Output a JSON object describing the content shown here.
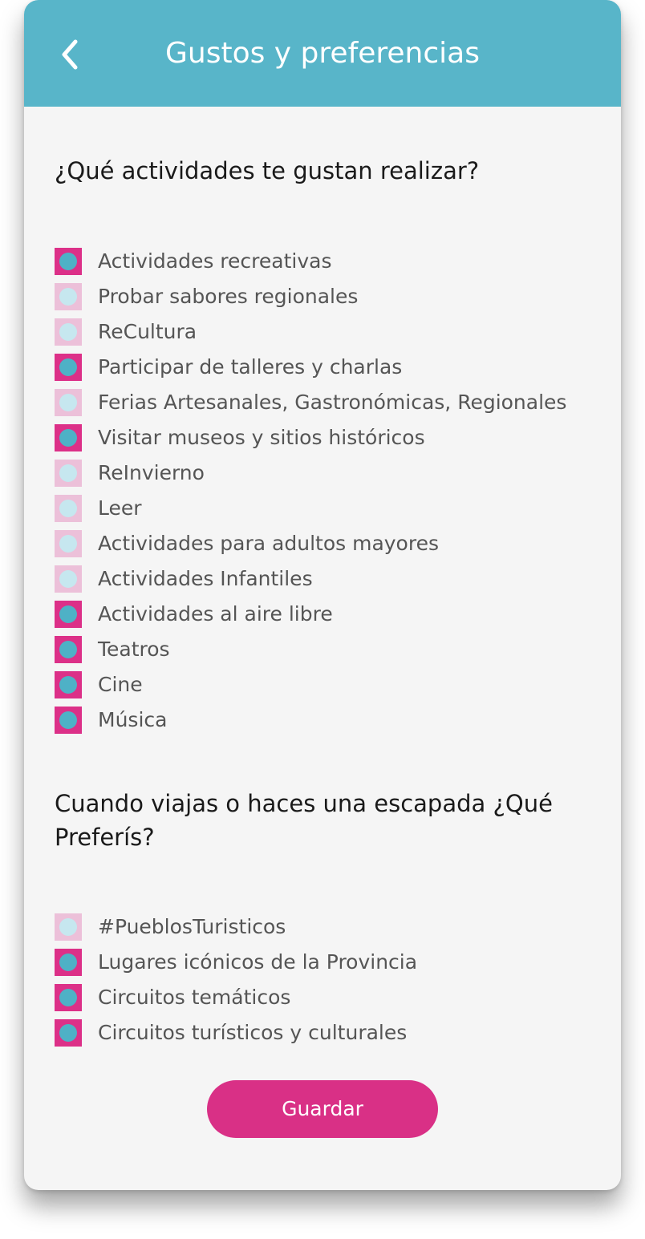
{
  "header": {
    "title": "Gustos y preferencias",
    "back_icon": "chevron-left-icon"
  },
  "colors": {
    "header_bg": "#58b5c9",
    "accent_pink": "#dc3088",
    "accent_teal": "#4eb1c6",
    "unchecked_pink": "#ecc0d9",
    "unchecked_teal": "#c6e7ef"
  },
  "activities": {
    "question": "¿Qué actividades te gustan realizar?",
    "options": [
      {
        "label": "Actividades recreativas",
        "checked": true
      },
      {
        "label": "Probar sabores regionales",
        "checked": false
      },
      {
        "label": "ReCultura",
        "checked": false
      },
      {
        "label": "Participar de talleres y charlas",
        "checked": true
      },
      {
        "label": "Ferias Artesanales, Gastronómicas, Regionales",
        "checked": false
      },
      {
        "label": "Visitar museos y sitios históricos",
        "checked": true
      },
      {
        "label": "ReInvierno",
        "checked": false
      },
      {
        "label": "Leer",
        "checked": false
      },
      {
        "label": "Actividades para adultos mayores",
        "checked": false
      },
      {
        "label": "Actividades Infantiles",
        "checked": false
      },
      {
        "label": "Actividades al aire libre",
        "checked": true
      },
      {
        "label": "Teatros",
        "checked": true
      },
      {
        "label": "Cine",
        "checked": true
      },
      {
        "label": "Música",
        "checked": true
      }
    ]
  },
  "travel": {
    "question": "Cuando viajas o haces una escapada ¿Qué Preferís?",
    "options": [
      {
        "label": "#PueblosTuristicos",
        "checked": false
      },
      {
        "label": "Lugares icónicos de la Provincia",
        "checked": true
      },
      {
        "label": "Circuitos temáticos",
        "checked": true
      },
      {
        "label": "Circuitos turísticos y culturales",
        "checked": true
      }
    ]
  },
  "actions": {
    "save_label": "Guardar"
  }
}
